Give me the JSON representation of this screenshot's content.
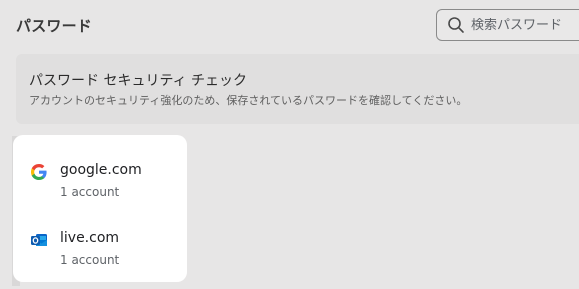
{
  "header": {
    "title": "パスワード"
  },
  "search": {
    "placeholder": "検索パスワード",
    "icon": "search-icon"
  },
  "checkup": {
    "title": "パスワード セキュリティ チェック",
    "description": "アカウントのセキュリティ強化のため、保存されているパスワードを確認してください。"
  },
  "sites": [
    {
      "name": "google.com",
      "accounts": "1 account",
      "icon": "google-icon"
    },
    {
      "name": "live.com",
      "accounts": "1 account",
      "icon": "outlook-icon"
    }
  ]
}
